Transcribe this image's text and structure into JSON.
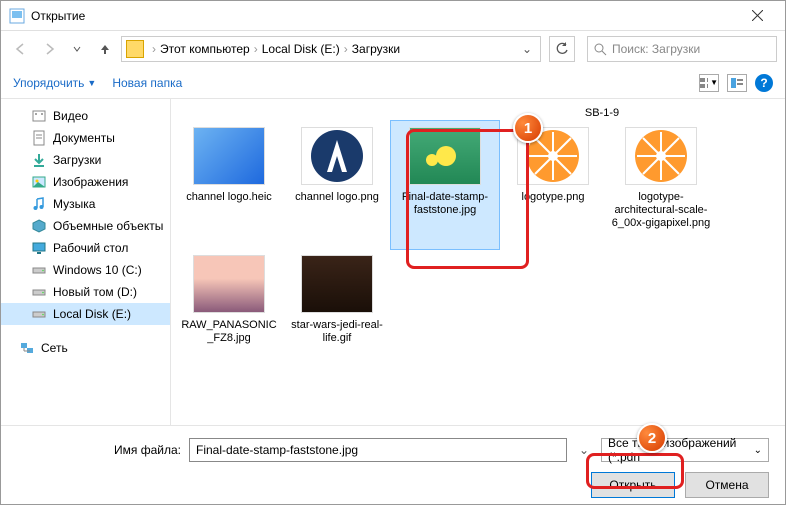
{
  "title": "Открытие",
  "breadcrumb": {
    "root": "Этот компьютер",
    "drive": "Local Disk (E:)",
    "folder": "Загрузки"
  },
  "search_placeholder": "Поиск: Загрузки",
  "toolbar": {
    "organize": "Упорядочить",
    "new_folder": "Новая папка"
  },
  "sidebar": [
    {
      "label": "Видео",
      "icon": "video"
    },
    {
      "label": "Документы",
      "icon": "docs"
    },
    {
      "label": "Загрузки",
      "icon": "downloads"
    },
    {
      "label": "Изображения",
      "icon": "pictures"
    },
    {
      "label": "Музыка",
      "icon": "music"
    },
    {
      "label": "Объемные объекты",
      "icon": "3d"
    },
    {
      "label": "Рабочий стол",
      "icon": "desktop"
    },
    {
      "label": "Windows 10 (C:)",
      "icon": "drive"
    },
    {
      "label": "Новый том (D:)",
      "icon": "drive"
    },
    {
      "label": "Local Disk (E:)",
      "icon": "drive",
      "selected": true
    }
  ],
  "network_label": "Сеть",
  "truncated_file": "SB-1-9",
  "files": [
    {
      "name": "channel logo.heic",
      "thumb": "generic"
    },
    {
      "name": "channel logo.png",
      "thumb": "logo"
    },
    {
      "name": "Final-date-stamp-faststone.jpg",
      "thumb": "flower",
      "selected": true
    },
    {
      "name": "logotype.png",
      "thumb": "orange"
    },
    {
      "name": "logotype-architectural-scale-6_00x-gigapixel.png",
      "thumb": "orange"
    },
    {
      "name": "RAW_PANASONIC_FZ8.jpg",
      "thumb": "sunset"
    },
    {
      "name": "star-wars-jedi-real-life.gif",
      "thumb": "sw"
    }
  ],
  "footer": {
    "filename_label": "Имя файла:",
    "filename_value": "Final-date-stamp-faststone.jpg",
    "filter": "Все типы изображений (*.pdn",
    "open": "Открыть",
    "cancel": "Отмена"
  },
  "callouts": {
    "one": "1",
    "two": "2"
  }
}
